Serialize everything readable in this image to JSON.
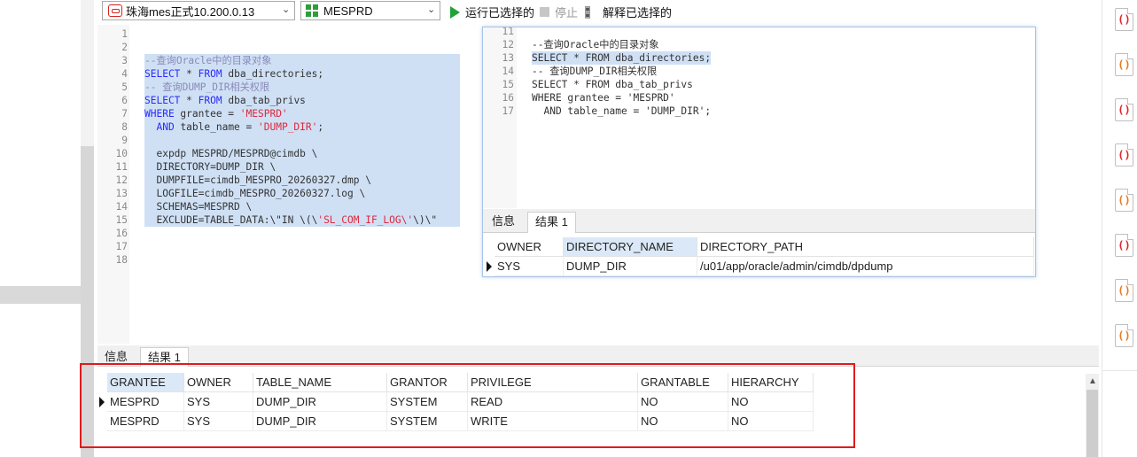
{
  "toolbar": {
    "connection": "珠海mes正式10.200.0.13",
    "schema": "MESPRD",
    "run_selected": "运行已选择的",
    "stop": "停止",
    "explain_selected": "解释已选择的"
  },
  "editor": {
    "lines": [
      {
        "n": "1",
        "text": ""
      },
      {
        "n": "2",
        "text": ""
      },
      {
        "n": "3",
        "text": "--查询Oracle中的目录对象",
        "cls": "cm",
        "sel": true
      },
      {
        "n": "4",
        "text": "SELECT * FROM dba_directories;",
        "sel": true
      },
      {
        "n": "5",
        "text": "-- 查询DUMP_DIR相关权限",
        "cls": "cm",
        "sel": true
      },
      {
        "n": "6",
        "text": "SELECT * FROM dba_tab_privs",
        "sel": true
      },
      {
        "n": "7",
        "text": "WHERE grantee = 'MESPRD'",
        "sel": true
      },
      {
        "n": "8",
        "text": "  AND table_name = 'DUMP_DIR';",
        "sel": true
      },
      {
        "n": "9",
        "text": "  ",
        "sel": true
      },
      {
        "n": "10",
        "text": "  expdp MESPRD/MESPRD@cimdb \\",
        "sel": true
      },
      {
        "n": "11",
        "text": "  DIRECTORY=DUMP_DIR \\",
        "sel": true
      },
      {
        "n": "12",
        "text": "  DUMPFILE=cimdb_MESPRO_20260327.dmp \\",
        "sel": true
      },
      {
        "n": "13",
        "text": "  LOGFILE=cimdb_MESPRO_20260327.log \\",
        "sel": true
      },
      {
        "n": "14",
        "text": "  SCHEMAS=MESPRD \\",
        "sel": true
      },
      {
        "n": "15",
        "text": "  EXCLUDE=TABLE_DATA:\\\"IN \\(\\'SL_COM_IF_LOG\\'\\)\\\"",
        "sel": true
      },
      {
        "n": "16",
        "text": ""
      },
      {
        "n": "17",
        "text": ""
      },
      {
        "n": "18",
        "text": ""
      }
    ]
  },
  "popup": {
    "lines": [
      {
        "n": "11",
        "text": ""
      },
      {
        "n": "12",
        "text": "--查询Oracle中的目录对象"
      },
      {
        "n": "13",
        "text": "SELECT * FROM dba_directories;",
        "sel": true
      },
      {
        "n": "14",
        "text": "-- 查询DUMP_DIR相关权限"
      },
      {
        "n": "15",
        "text": "SELECT * FROM dba_tab_privs"
      },
      {
        "n": "16",
        "text": "WHERE grantee = 'MESPRD'"
      },
      {
        "n": "17",
        "text": "  AND table_name = 'DUMP_DIR';"
      }
    ],
    "tabs": [
      "信息",
      "结果 1"
    ],
    "columns": [
      "OWNER",
      "DIRECTORY_NAME",
      "DIRECTORY_PATH"
    ],
    "rows": [
      [
        "SYS",
        "DUMP_DIR",
        "/u01/app/oracle/admin/cimdb/dpdump"
      ]
    ]
  },
  "results": {
    "tabs": [
      "信息",
      "结果 1"
    ],
    "columns": [
      "GRANTEE",
      "OWNER",
      "TABLE_NAME",
      "GRANTOR",
      "PRIVILEGE",
      "GRANTABLE",
      "HIERARCHY"
    ],
    "rows": [
      [
        "MESPRD",
        "SYS",
        "DUMP_DIR",
        "SYSTEM",
        "READ",
        "NO",
        "NO"
      ],
      [
        "MESPRD",
        "SYS",
        "DUMP_DIR",
        "SYSTEM",
        "WRITE",
        "NO",
        "NO"
      ]
    ]
  },
  "right_panel": {
    "icons": [
      "sql-file-icon",
      "multi-file-icon",
      "sql-file-icon",
      "sql-file-icon",
      "multi-file-icon",
      "sql-file-icon",
      "multi-file-icon",
      "multi-file-icon"
    ]
  },
  "colors": {
    "selection": "#cfe0f5",
    "keyword": "#2a2aff",
    "string": "#e0283c",
    "comment": "#8a8ab8",
    "highlight_box": "#e01b1b"
  }
}
